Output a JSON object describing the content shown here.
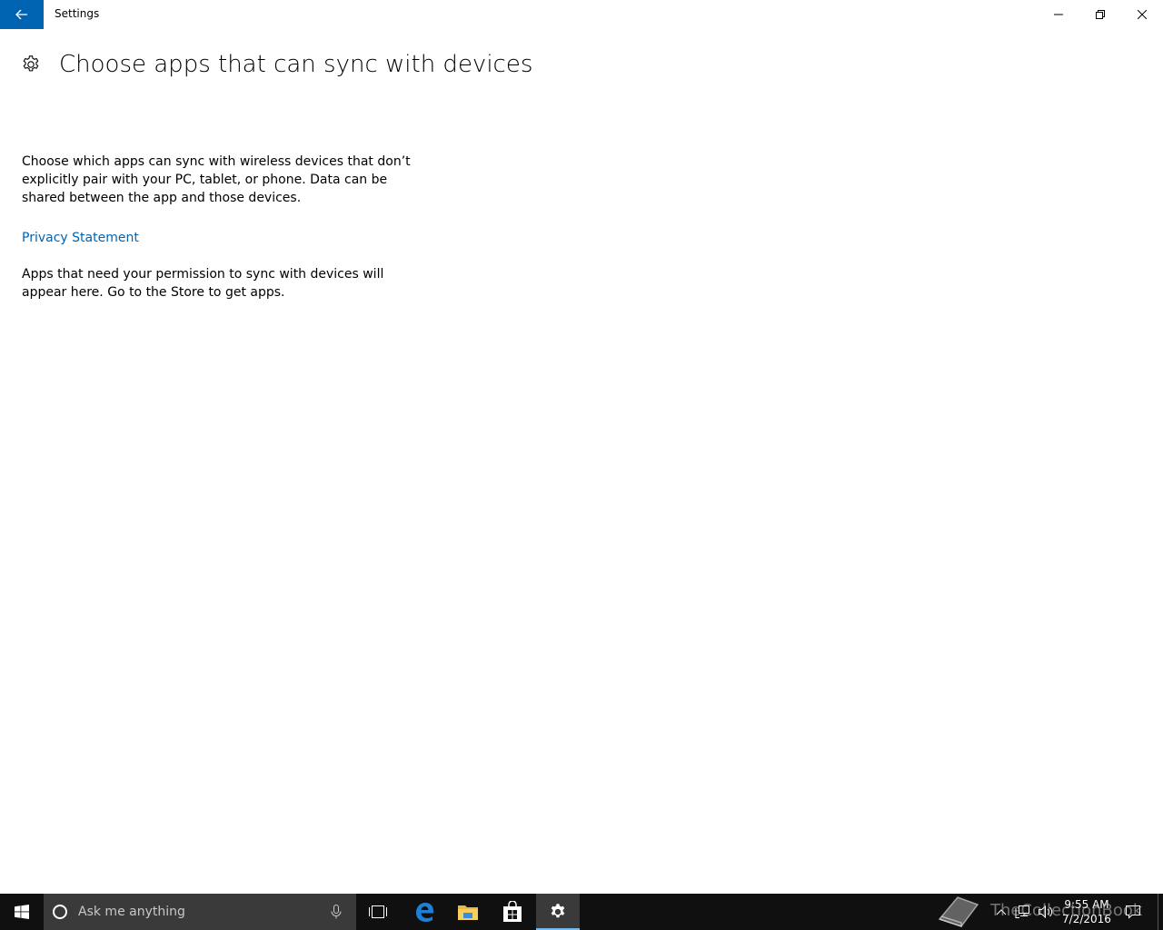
{
  "window": {
    "title": "Settings"
  },
  "page": {
    "title": "Choose apps that can sync with devices",
    "description": "Choose which apps can sync with wireless devices that don’t explicitly pair with your PC, tablet, or phone. Data can be shared between the app and those devices.",
    "privacy_link": "Privacy Statement",
    "empty_message": "Apps that need your permission to sync with devices will appear here. Go to the Store to get apps."
  },
  "taskbar": {
    "search_placeholder": "Ask me anything",
    "time": "9:55 AM",
    "date": "7/2/2016",
    "pinned": [
      "task-view",
      "edge",
      "file-explorer",
      "store",
      "settings"
    ],
    "active": "settings"
  },
  "watermark": {
    "text": "TheCollectionBook"
  },
  "colors": {
    "accent": "#0063b1",
    "taskbar": "#101010",
    "search_box": "#3a3a3a",
    "active_indicator": "#76b9ed"
  }
}
